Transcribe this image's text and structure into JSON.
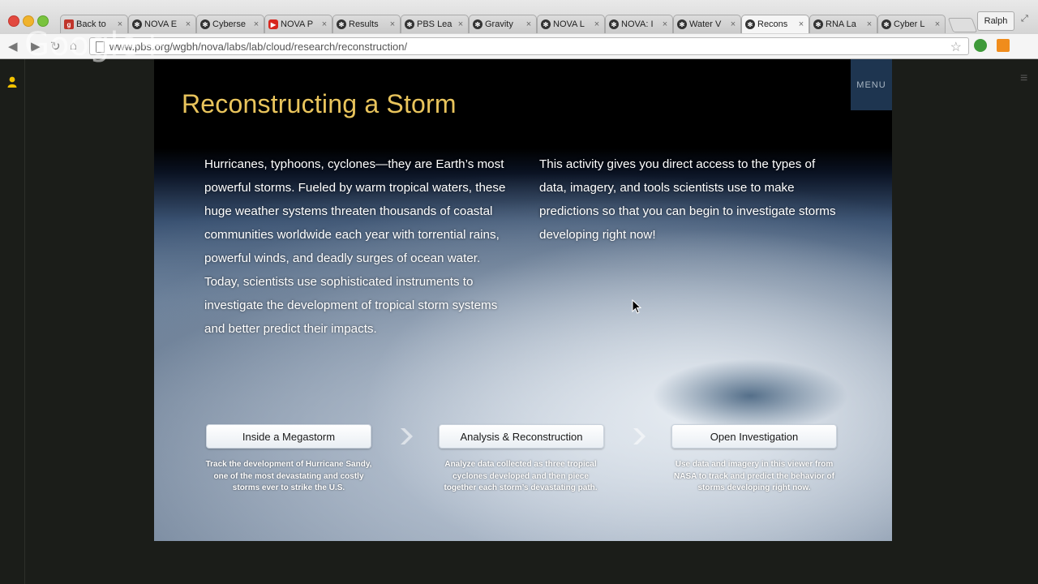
{
  "browser": {
    "tabs": [
      {
        "title": "Back to",
        "favicon": "google-plus-icon"
      },
      {
        "title": "NOVA E",
        "favicon": "pbs-icon"
      },
      {
        "title": "Cyberse",
        "favicon": "pbs-icon"
      },
      {
        "title": "NOVA P",
        "favicon": "youtube-icon"
      },
      {
        "title": "Results",
        "favicon": "pbs-icon"
      },
      {
        "title": "PBS Lea",
        "favicon": "pbs-icon"
      },
      {
        "title": "Gravity",
        "favicon": "pbs-icon"
      },
      {
        "title": "NOVA L",
        "favicon": "pbs-icon"
      },
      {
        "title": "NOVA: I",
        "favicon": "pbs-icon"
      },
      {
        "title": "Water V",
        "favicon": "pbs-icon"
      },
      {
        "title": "Recons",
        "favicon": "pbs-icon",
        "active": true
      },
      {
        "title": "RNA La",
        "favicon": "pbs-icon"
      },
      {
        "title": "Cyber L",
        "favicon": "pbs-icon"
      }
    ],
    "profile_name": "Ralph",
    "url": "www.pbs.org/wgbh/nova/labs/lab/cloud/research/reconstruction/",
    "watermark": "Google+"
  },
  "page": {
    "title": "Reconstructing a Storm",
    "menu_label": "MENU",
    "intro_left": "Hurricanes, typhoons, cyclones—they are Earth’s most powerful storms. Fueled by warm tropical waters, these huge weather systems threaten thousands of coastal communities worldwide each year with torrential rains, powerful winds, and deadly surges of ocean water. Today, scientists use sophisticated instruments to investigate the development of tropical storm systems and better predict their impacts.",
    "intro_right": "This activity gives you direct access to the types of data, imagery, and tools scientists use to make predictions so that you can begin to investigate storms developing right now!",
    "steps": [
      {
        "label": "Inside a Megastorm",
        "description": "Track the development of Hurricane Sandy, one of the most devastating and costly storms ever to strike the U.S."
      },
      {
        "label": "Analysis & Reconstruction",
        "description": "Analyze data collected as three tropical cyclones developed and then piece together each storm’s devastating path."
      },
      {
        "label": "Open Investigation",
        "description": "Use data and imagery in this viewer from NASA to track and predict the behavior of storms developing right now."
      }
    ]
  },
  "colors": {
    "title_gold": "#e9c45c",
    "menu_bg": "#1e3550"
  }
}
